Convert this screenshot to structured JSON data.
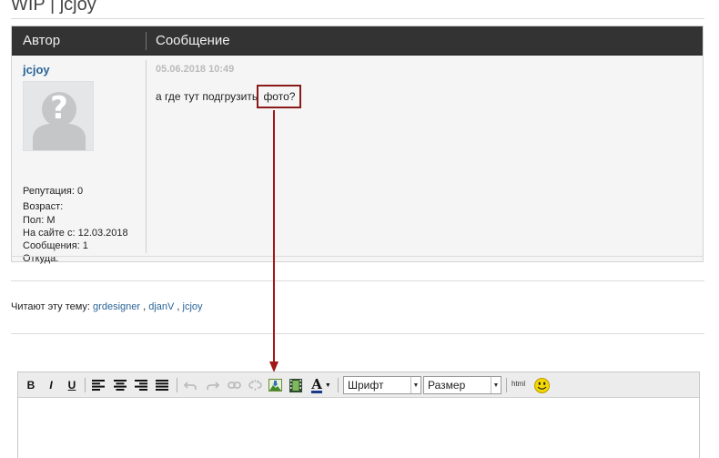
{
  "page": {
    "title": "WIP | jcjoy"
  },
  "table": {
    "author_header": "Автор",
    "message_header": "Сообщение"
  },
  "post": {
    "author": "jcjoy",
    "stats": {
      "reputation": "Репутация: 0",
      "age": "Возраст:",
      "gender": "Пол: М",
      "since": "На сайте с: 12.03.2018",
      "messages": "Сообщения: 1",
      "from": "Откуда:"
    },
    "date": "05.06.2018 10:49",
    "text_before": "а где тут подгрузить ",
    "text_highlight": "фото?"
  },
  "readers": {
    "label": "Читают эту тему:",
    "users": [
      "grdesigner",
      "djanV",
      "jcjoy"
    ],
    "sep": ","
  },
  "editor": {
    "bold": "B",
    "italic": "I",
    "underline": "U",
    "font_select": "Шрифт",
    "size_select": "Размер",
    "html_label": "html",
    "text_color_glyph": "A"
  },
  "colors": {
    "header_bg": "#333333",
    "link": "#2a6496",
    "highlight_box": "#8b1a1a",
    "arrow": "#a01818"
  }
}
